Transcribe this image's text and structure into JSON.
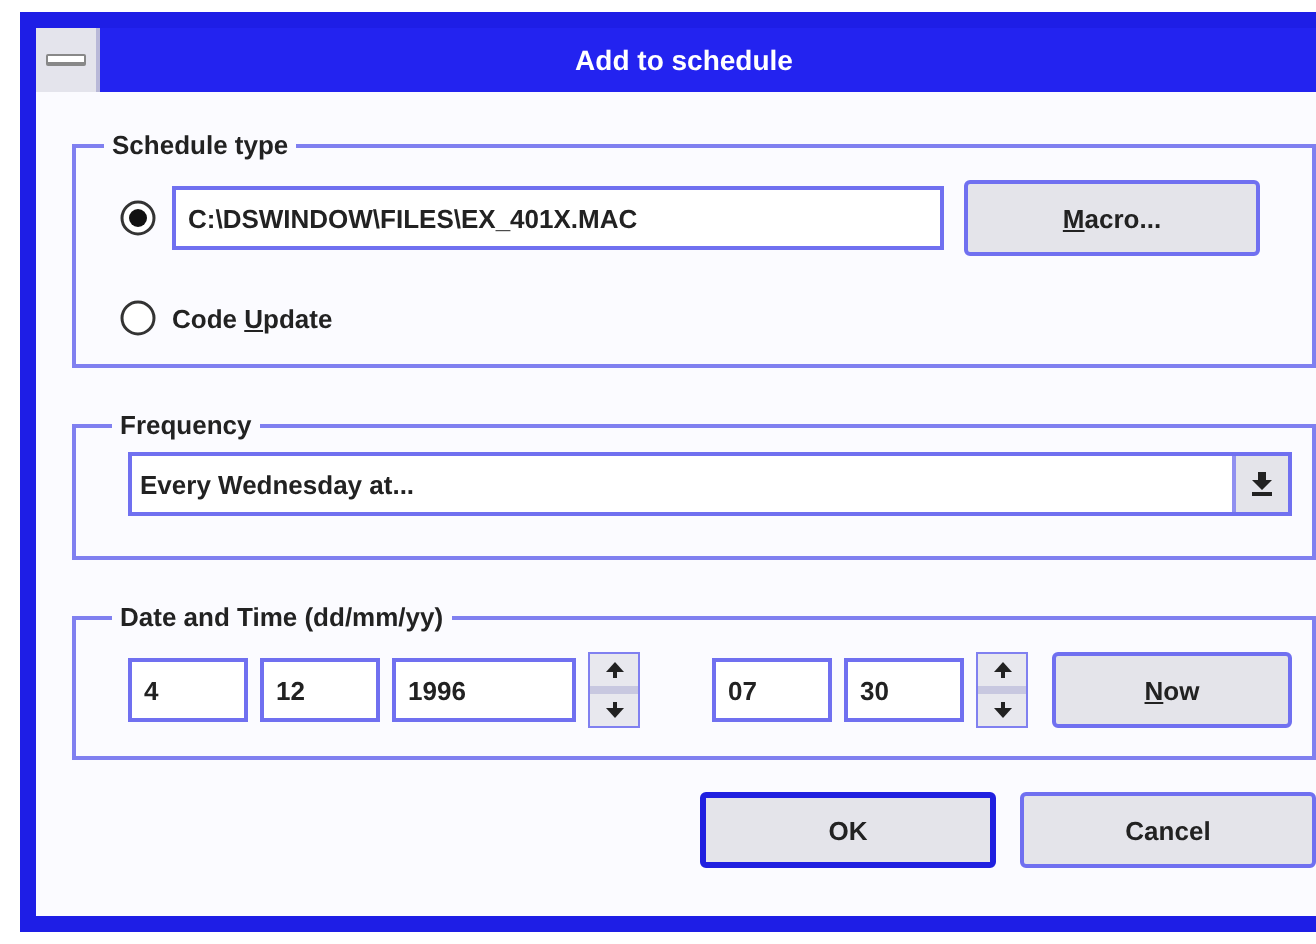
{
  "window": {
    "title": "Add to schedule"
  },
  "schedule_type": {
    "legend": "Schedule type",
    "options": [
      {
        "kind": "file",
        "selected": true,
        "value": "C:\\DSWINDOW\\FILES\\EX_401X.MAC",
        "button": {
          "label": [
            {
              "text": "M",
              "underlined": true
            },
            {
              "text": "acro...",
              "underlined": false
            }
          ]
        }
      },
      {
        "kind": "label",
        "selected": false,
        "label": [
          {
            "text": "Code ",
            "underlined": false
          },
          {
            "text": "U",
            "underlined": true
          },
          {
            "text": "pdate",
            "underlined": false
          }
        ]
      }
    ]
  },
  "frequency": {
    "legend": "Frequency",
    "value": "Every Wednesday at..."
  },
  "date_time": {
    "legend": "Date and Time (dd/mm/yy)",
    "date": [
      "4",
      "12",
      "1996"
    ],
    "time": [
      "07",
      "30"
    ],
    "now_button": {
      "label": [
        {
          "text": "N",
          "underlined": true
        },
        {
          "text": "ow",
          "underlined": false
        }
      ]
    }
  },
  "buttons": [
    {
      "label": "OK",
      "default": true
    },
    {
      "label": "Cancel",
      "default": false
    }
  ]
}
